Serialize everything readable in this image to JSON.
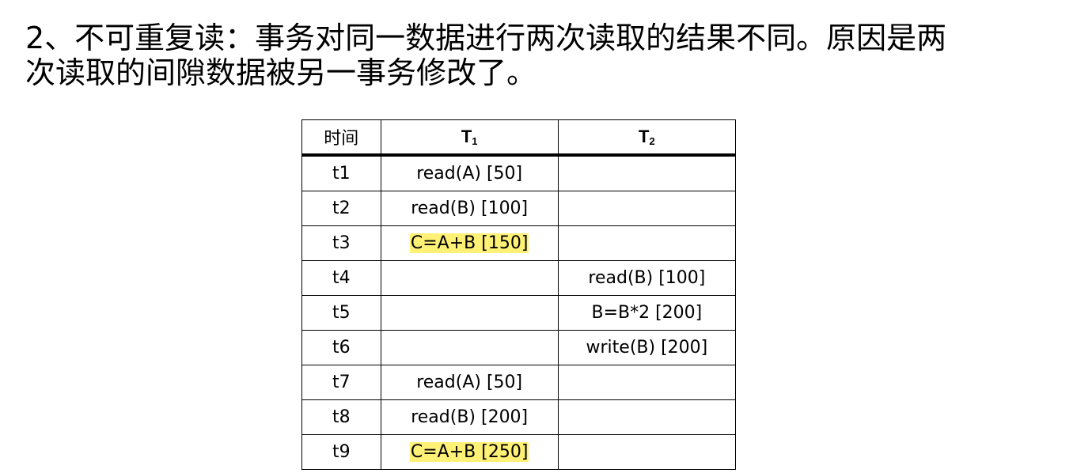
{
  "paragraph": {
    "line1": "2、不可重复读：事务对同一数据进行两次读取的结果不同。原因是两",
    "line2": "次读取的间隙数据被另一事务修改了。"
  },
  "table": {
    "headers": {
      "time": "时间",
      "t1_base": "T",
      "t1_sub": "1",
      "t2_base": "T",
      "t2_sub": "2"
    },
    "rows": [
      {
        "time": "t1",
        "t1": "read(A) [50]",
        "t2": "",
        "t1_highlight": false
      },
      {
        "time": "t2",
        "t1": "read(B) [100]",
        "t2": "",
        "t1_highlight": false
      },
      {
        "time": "t3",
        "t1": "C=A+B [150]",
        "t2": "",
        "t1_highlight": true
      },
      {
        "time": "t4",
        "t1": "",
        "t2": "read(B) [100]",
        "t1_highlight": false
      },
      {
        "time": "t5",
        "t1": "",
        "t2": "B=B*2 [200]",
        "t1_highlight": false
      },
      {
        "time": "t6",
        "t1": "",
        "t2": "write(B) [200]",
        "t1_highlight": false
      },
      {
        "time": "t7",
        "t1": "read(A) [50]",
        "t2": "",
        "t1_highlight": false
      },
      {
        "time": "t8",
        "t1": "read(B) [200]",
        "t2": "",
        "t1_highlight": false
      },
      {
        "time": "t9",
        "t1": "C=A+B [250]",
        "t2": "",
        "t1_highlight": true
      }
    ],
    "highlight_color": "#fff176"
  }
}
